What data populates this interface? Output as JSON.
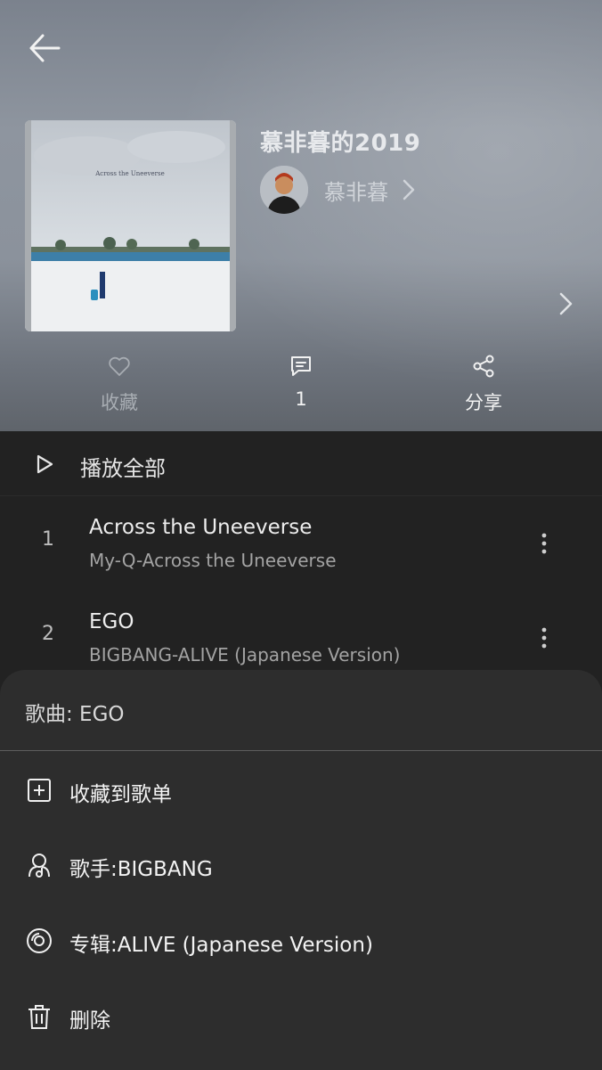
{
  "playlist": {
    "title": "慕非暮的2019",
    "creator": "慕非暮",
    "cover_title": "Across the Uneeverse"
  },
  "actions": {
    "collect": "收藏",
    "comment_count": "1",
    "share": "分享"
  },
  "list": {
    "play_all": "播放全部",
    "songs": [
      {
        "index": "1",
        "name": "Across the Uneeverse",
        "sub": "My-Q-Across the Uneeverse"
      },
      {
        "index": "2",
        "name": "EGO",
        "sub": "BIGBANG-ALIVE (Japanese Version)"
      }
    ]
  },
  "sheet": {
    "title": "歌曲: EGO",
    "options": [
      {
        "label": "收藏到歌单",
        "icon": "add-box-icon"
      },
      {
        "label": "歌手:BIGBANG",
        "icon": "artist-icon"
      },
      {
        "label": "专辑:ALIVE (Japanese Version)",
        "icon": "album-icon"
      },
      {
        "label": "删除",
        "icon": "trash-icon"
      }
    ]
  }
}
